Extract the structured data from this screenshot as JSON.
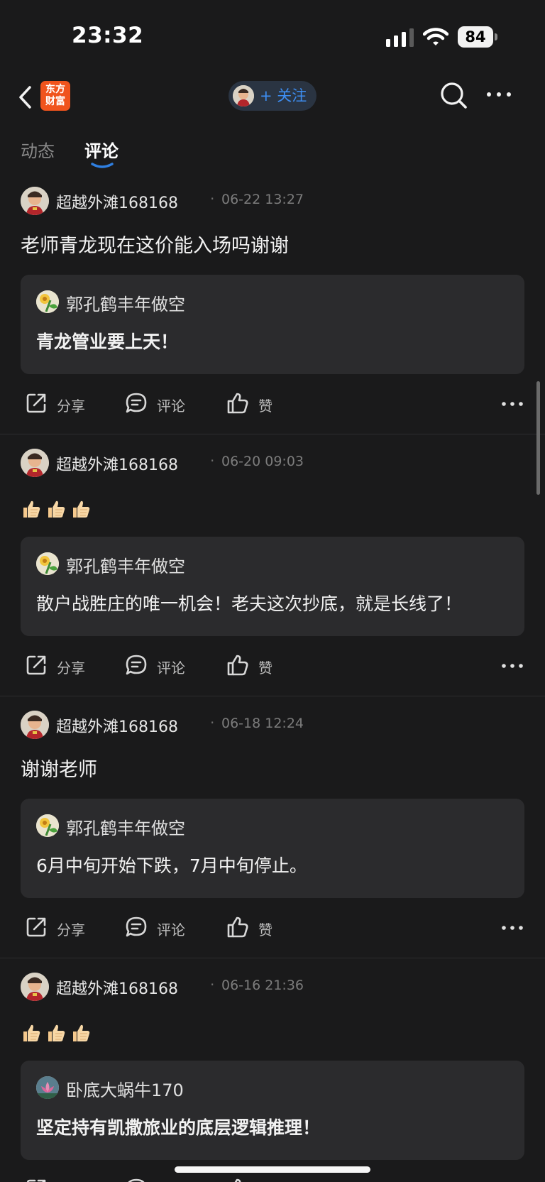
{
  "status_bar": {
    "time": "23:32",
    "battery": "84"
  },
  "nav": {
    "brand_line1": "东方",
    "brand_line2": "财富",
    "follow_label": "+ 关注"
  },
  "tabs": [
    {
      "label": "动态",
      "active": false
    },
    {
      "label": "评论",
      "active": true
    }
  ],
  "actions": {
    "share": "分享",
    "comment": "评论",
    "like": "赞"
  },
  "posts": [
    {
      "author": "超越外滩168168",
      "separator": "·",
      "time": "06-22 13:27",
      "content": "老师青龙现在这价能入场吗谢谢",
      "thumbs_count": 0,
      "quote": {
        "author": "郭孔鹤丰年做空",
        "text": "青龙管业要上天！",
        "bold": true,
        "avatar": "yellow-flower"
      }
    },
    {
      "author": "超越外滩168168",
      "separator": "·",
      "time": "06-20 09:03",
      "content": "",
      "thumbs_count": 3,
      "quote": {
        "author": "郭孔鹤丰年做空",
        "text": "散户战胜庄的唯一机会！老夫这次抄底，就是长线了！",
        "bold": false,
        "avatar": "yellow-flower"
      }
    },
    {
      "author": "超越外滩168168",
      "separator": "·",
      "time": "06-18 12:24",
      "content": "谢谢老师",
      "thumbs_count": 0,
      "quote": {
        "author": "郭孔鹤丰年做空",
        "text": "6月中旬开始下跌，7月中旬停止。",
        "bold": false,
        "avatar": "yellow-flower"
      }
    },
    {
      "author": "超越外滩168168",
      "separator": "·",
      "time": "06-16 21:36",
      "content": "",
      "thumbs_count": 3,
      "quote": {
        "author": "卧底大蜗牛170",
        "text": "坚定持有凯撒旅业的底层逻辑推理！",
        "bold": true,
        "avatar": "lotus"
      }
    }
  ],
  "colors": {
    "background": "#1a1a1b",
    "card": "#2b2b2d",
    "accent_blue": "#3d8ef2",
    "brand_orange": "#f0541d"
  }
}
